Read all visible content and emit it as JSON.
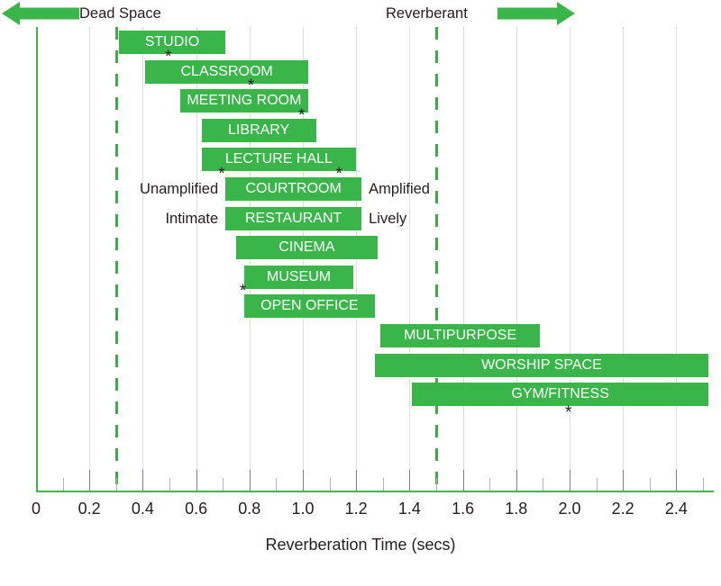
{
  "header": {
    "left_label": "Dead Space",
    "right_label": "Reverberant",
    "arrow_left_icon": "arrow-left-icon",
    "arrow_right_icon": "arrow-right-icon"
  },
  "colors": {
    "bar": "#3ab54a",
    "axis": "#4caf50",
    "gridline": "#dddddd",
    "dashed_reference": "#3faa4a",
    "text": "#231f20",
    "bar_label": "#ffffff"
  },
  "annotations": {
    "courtroom_left": "Unamplified",
    "courtroom_right": "Amplified",
    "restaurant_left": "Intimate",
    "restaurant_right": "Lively",
    "asterisk": "*"
  },
  "chart_data": {
    "type": "bar",
    "orientation": "horizontal",
    "subtype": "range-bar",
    "title": "",
    "xlabel": "Reverberation Time (secs)",
    "ylabel": "",
    "xlim": [
      0,
      2.54
    ],
    "grid": true,
    "legend": null,
    "xticks": [
      0,
      0.2,
      0.4,
      0.6,
      0.8,
      1.0,
      1.2,
      1.4,
      1.6,
      1.8,
      2.0,
      2.2,
      2.4
    ],
    "xtick_labels": [
      "0",
      "0.2",
      "0.4",
      "0.6",
      "0.8",
      "1.0",
      "1.2",
      "1.4",
      "1.6",
      "1.8",
      "2.0",
      "2.2",
      "2.4"
    ],
    "minor_tick_step": 0.1,
    "reference_lines": [
      {
        "value": 0.3,
        "style": "dashed",
        "color": "#3faa4a"
      },
      {
        "value": 1.5,
        "style": "dashed",
        "color": "#3faa4a"
      }
    ],
    "categories": [
      "STUDIO",
      "CLASSROOM",
      "MEETING ROOM",
      "LIBRARY",
      "LECTURE HALL",
      "COURTROOM",
      "RESTAURANT",
      "CINEMA",
      "MUSEUM",
      "OPEN OFFICE",
      "MULTIPURPOSE",
      "WORSHIP SPACE",
      "GYM/FITNESS"
    ],
    "ranges": [
      {
        "label": "STUDIO",
        "start": 0.31,
        "end": 0.71,
        "markers": []
      },
      {
        "label": "CLASSROOM",
        "start": 0.41,
        "end": 1.02,
        "markers": [
          0.5
        ]
      },
      {
        "label": "MEETING ROOM",
        "start": 0.54,
        "end": 1.02,
        "markers": [
          0.81
        ]
      },
      {
        "label": "LIBRARY",
        "start": 0.62,
        "end": 1.05,
        "markers": [
          1.0
        ]
      },
      {
        "label": "LECTURE HALL",
        "start": 0.62,
        "end": 1.2,
        "markers": []
      },
      {
        "label": "COURTROOM",
        "start": 0.71,
        "end": 1.22,
        "markers": [
          0.7,
          1.14
        ]
      },
      {
        "label": "RESTAURANT",
        "start": 0.71,
        "end": 1.22,
        "markers": []
      },
      {
        "label": "CINEMA",
        "start": 0.75,
        "end": 1.28,
        "markers": []
      },
      {
        "label": "MUSEUM",
        "start": 0.78,
        "end": 1.19,
        "markers": []
      },
      {
        "label": "OPEN OFFICE",
        "start": 0.78,
        "end": 1.27,
        "markers": [
          0.78
        ]
      },
      {
        "label": "MULTIPURPOSE",
        "start": 1.29,
        "end": 1.89,
        "markers": []
      },
      {
        "label": "WORSHIP SPACE",
        "start": 1.27,
        "end": 2.52,
        "markers": []
      },
      {
        "label": "GYM/FITNESS",
        "start": 1.41,
        "end": 2.52,
        "markers": [
          2.0
        ]
      }
    ]
  }
}
